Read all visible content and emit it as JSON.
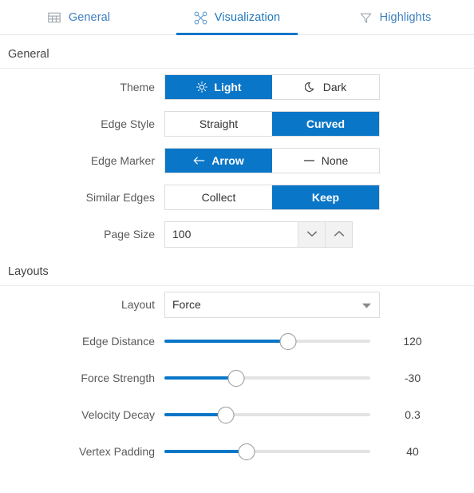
{
  "tabs": [
    {
      "label": "General",
      "icon": "table-icon",
      "active": false
    },
    {
      "label": "Visualization",
      "icon": "graph-icon",
      "active": true
    },
    {
      "label": "Highlights",
      "icon": "funnel-icon",
      "active": false
    }
  ],
  "sections": {
    "general": {
      "title": "General",
      "theme": {
        "label": "Theme",
        "options": [
          {
            "label": "Light",
            "icon": "sun-icon",
            "selected": true
          },
          {
            "label": "Dark",
            "icon": "moon-icon",
            "selected": false
          }
        ]
      },
      "edge_style": {
        "label": "Edge Style",
        "options": [
          {
            "label": "Straight",
            "icon": "none",
            "selected": false
          },
          {
            "label": "Curved",
            "icon": "none",
            "selected": true
          }
        ]
      },
      "edge_marker": {
        "label": "Edge Marker",
        "options": [
          {
            "label": "Arrow",
            "icon": "arrow-left-icon",
            "selected": true
          },
          {
            "label": "None",
            "icon": "dash-icon",
            "selected": false
          }
        ]
      },
      "similar_edges": {
        "label": "Similar Edges",
        "options": [
          {
            "label": "Collect",
            "icon": "none",
            "selected": false
          },
          {
            "label": "Keep",
            "icon": "none",
            "selected": true
          }
        ]
      },
      "page_size": {
        "label": "Page Size",
        "value": "100",
        "decrement_icon": "chevron-down-icon",
        "increment_icon": "chevron-up-icon"
      }
    },
    "layouts": {
      "title": "Layouts",
      "layout": {
        "label": "Layout",
        "value": "Force",
        "caret_icon": "caret-down-icon"
      },
      "sliders": [
        {
          "label": "Edge Distance",
          "value": "120",
          "percent": 60
        },
        {
          "label": "Force Strength",
          "value": "-30",
          "percent": 35
        },
        {
          "label": "Velocity Decay",
          "value": "0.3",
          "percent": 30
        },
        {
          "label": "Vertex Padding",
          "value": "40",
          "percent": 40
        }
      ]
    }
  },
  "colors": {
    "accent": "#0a76c8",
    "tab_text": "#3f7fbf",
    "track": "#e3e3e3",
    "border": "#dcdcdc"
  }
}
